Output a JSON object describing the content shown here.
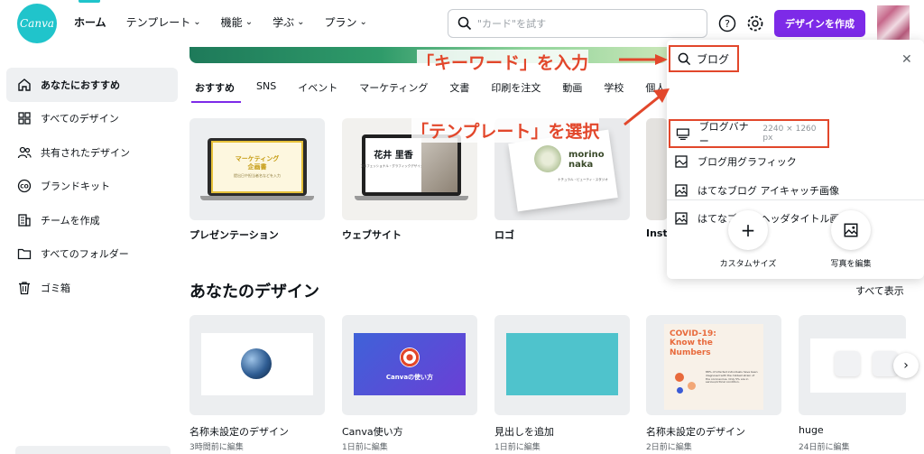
{
  "brand": {
    "name": "Canva",
    "color": "#20c4cb",
    "accent": "#7d2ae8",
    "annotation_color": "#e2472b"
  },
  "nav": {
    "items": [
      {
        "label": "ホーム"
      },
      {
        "label": "テンプレート"
      },
      {
        "label": "機能"
      },
      {
        "label": "学ぶ"
      },
      {
        "label": "プラン"
      }
    ]
  },
  "search": {
    "placeholder": "\"カード\"を試す"
  },
  "header": {
    "create_label": "デザインを作成"
  },
  "sidebar": {
    "items": [
      {
        "label": "あなたにおすすめ",
        "icon": "home-icon"
      },
      {
        "label": "すべてのデザイン",
        "icon": "grid-icon"
      },
      {
        "label": "共有されたデザイン",
        "icon": "users-icon"
      },
      {
        "label": "ブランドキット",
        "icon": "brand-kit-icon"
      },
      {
        "label": "チームを作成",
        "icon": "team-icon"
      },
      {
        "label": "すべてのフォルダー",
        "icon": "folder-icon"
      },
      {
        "label": "ゴミ箱",
        "icon": "trash-icon"
      }
    ]
  },
  "tabs": [
    "おすすめ",
    "SNS",
    "イベント",
    "マーケティング",
    "文書",
    "印刷を注文",
    "動画",
    "学校",
    "個人"
  ],
  "templates": [
    {
      "label": "プレゼンテーション",
      "thumb_title": "マーケティング\n企画書",
      "thumb_sub": "提出日や担当者名などを入力"
    },
    {
      "label": "ウェブサイト",
      "thumb_title": "花井 里香",
      "thumb_sub": "プロフェッショナル・グラフィックデザイナー"
    },
    {
      "label": "ロゴ",
      "thumb_title": "morino\nnaka",
      "thumb_sub": "ナチュラル・ビューティ・スタジオ"
    },
    {
      "label": "Insta"
    }
  ],
  "designs_section": {
    "title": "あなたのデザイン",
    "see_all": "すべて表示"
  },
  "designs": [
    {
      "name": "名称未設定のデザイン",
      "time": "3時間前に編集"
    },
    {
      "name": "Canva使い方",
      "time": "1日前に編集",
      "thumb_text": "Canvaの使い方"
    },
    {
      "name": "見出しを追加",
      "time": "1日前に編集"
    },
    {
      "name": "名称未設定のデザイン",
      "time": "2日前に編集",
      "thumb_title": "COVID-19: Know the Numbers",
      "thumb_body": "88% of infected individuals have been diagnosed with the mildest strain of the coronavirus. Only 5% are in serious/critical condition."
    },
    {
      "name": "huge",
      "time": "24日前に編集"
    }
  ],
  "dropdown": {
    "query": "ブログ",
    "results": [
      {
        "label": "ブログバナー",
        "size": "2240 × 1260 px",
        "icon": "banner-icon"
      },
      {
        "label": "ブログ用グラフィック",
        "icon": "graphic-icon"
      },
      {
        "label": "はてなブログ アイキャッチ画像",
        "icon": "image-icon"
      },
      {
        "label": "はてなブログ ヘッダタイトル画像",
        "icon": "image-icon"
      }
    ],
    "actions": [
      {
        "label": "カスタムサイズ",
        "icon": "plus-icon"
      },
      {
        "label": "写真を編集",
        "icon": "photo-edit-icon"
      }
    ]
  },
  "annotations": {
    "keyword": "「キーワード」を入力",
    "template": "「テンプレート」を選択"
  }
}
